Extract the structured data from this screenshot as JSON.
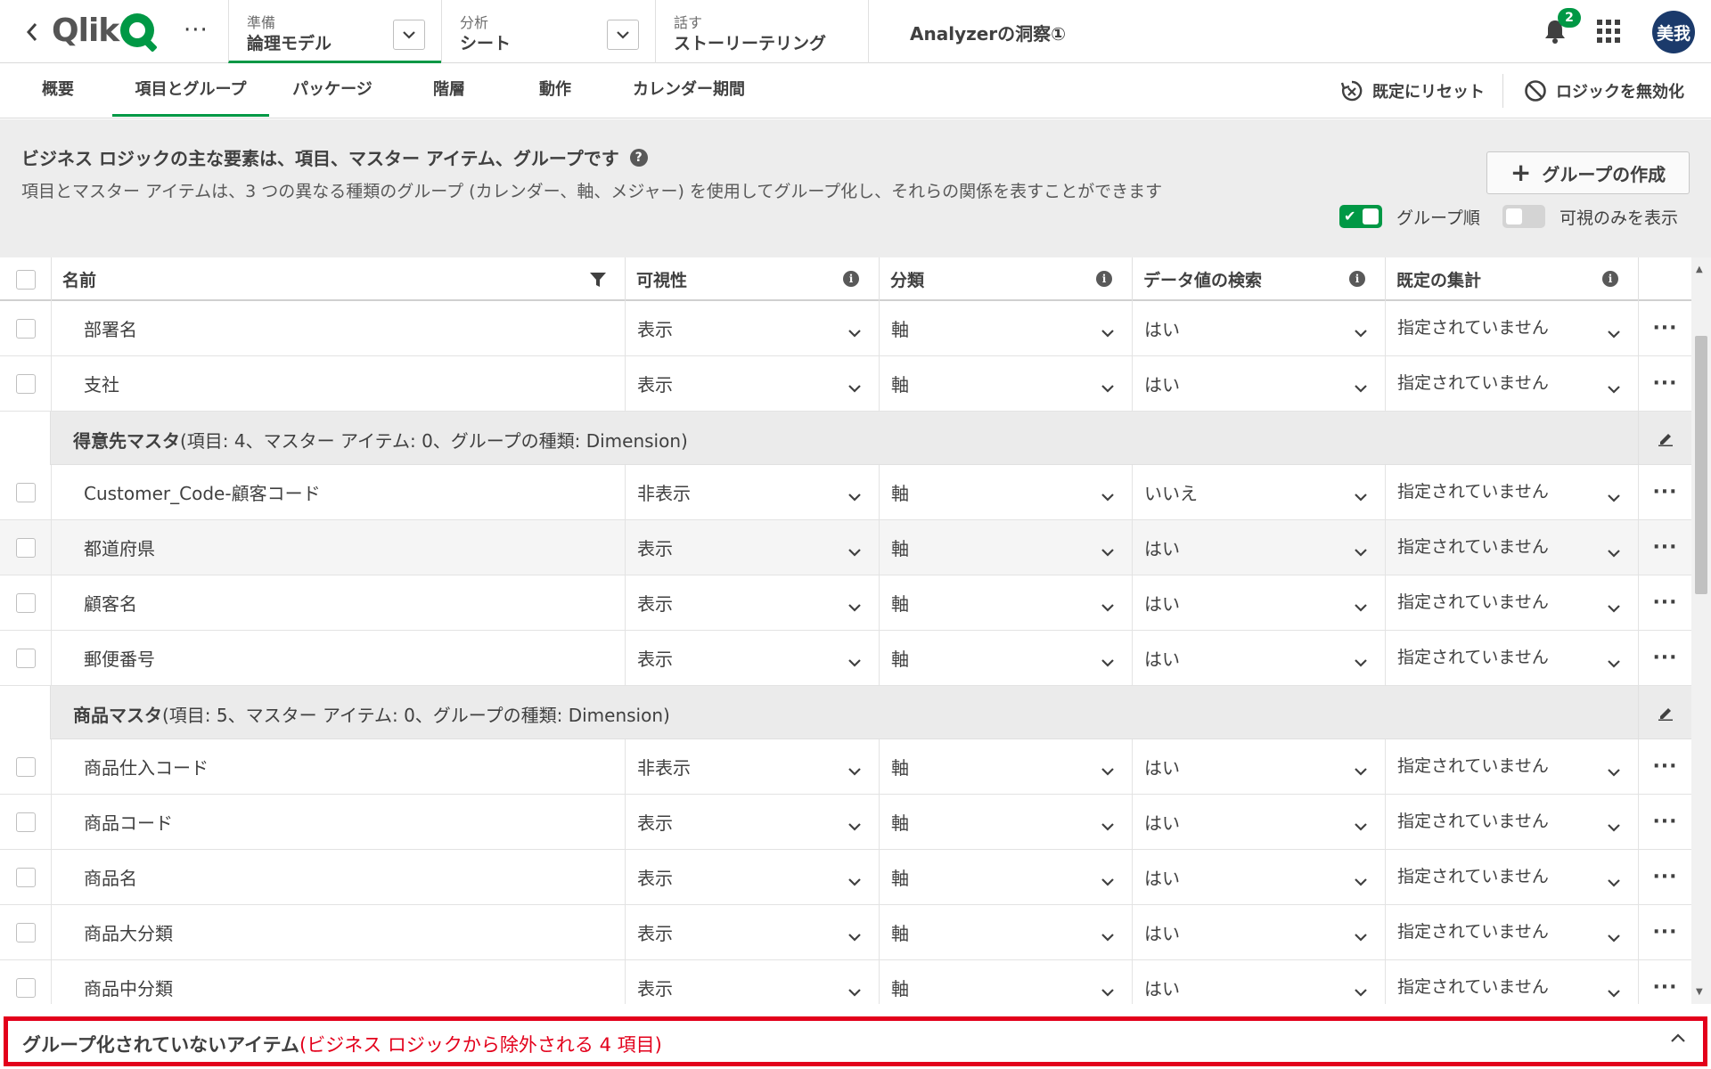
{
  "topbar": {
    "stages": [
      {
        "sublabel": "準備",
        "label": "論理モデル"
      },
      {
        "sublabel": "分析",
        "label": "シート"
      },
      {
        "sublabel": "話す",
        "label": "ストーリーテリング"
      }
    ],
    "app_title": "Analyzerの洞察①",
    "notification_count": "2",
    "avatar_initials": "美我",
    "logo_text": "Qlik"
  },
  "tabs": [
    {
      "label": "概要"
    },
    {
      "label": "項目とグループ"
    },
    {
      "label": "パッケージ"
    },
    {
      "label": "階層"
    },
    {
      "label": "動作"
    },
    {
      "label": "カレンダー期間"
    }
  ],
  "toolbar": {
    "reset_label": "既定にリセット",
    "disable_logic_label": "ロジックを無効化"
  },
  "info": {
    "title": "ビジネス ロジックの主な要素は、項目、マスター アイテム、グループです",
    "description": "項目とマスター アイテムは、3 つの異なる種類のグループ (カレンダー、軸、メジャー) を使用してグループ化し、それらの関係を表すことができます",
    "create_group_label": "グループの作成",
    "group_order_label": "グループ順",
    "visible_only_label": "可視のみを表示"
  },
  "table": {
    "columns": {
      "name": "名前",
      "visibility": "可視性",
      "classification": "分類",
      "search": "データ値の検索",
      "aggregation": "既定の集計"
    },
    "rows": [
      {
        "type": "item",
        "name": "部署名",
        "visibility": "表示",
        "classification": "軸",
        "search": "はい",
        "aggregation": "指定されていません"
      },
      {
        "type": "item",
        "name": "支社",
        "visibility": "表示",
        "classification": "軸",
        "search": "はい",
        "aggregation": "指定されていません"
      },
      {
        "type": "group",
        "title": "得意先マスタ",
        "detail": "(項目: 4、マスター アイテム: 0、グループの種類: Dimension)"
      },
      {
        "type": "item",
        "name": "Customer_Code-顧客コード",
        "visibility": "非表示",
        "classification": "軸",
        "search": "いいえ",
        "aggregation": "指定されていません"
      },
      {
        "type": "item",
        "name": "都道府県",
        "visibility": "表示",
        "classification": "軸",
        "search": "はい",
        "aggregation": "指定されていません",
        "hover": true
      },
      {
        "type": "item",
        "name": "顧客名",
        "visibility": "表示",
        "classification": "軸",
        "search": "はい",
        "aggregation": "指定されていません"
      },
      {
        "type": "item",
        "name": "郵便番号",
        "visibility": "表示",
        "classification": "軸",
        "search": "はい",
        "aggregation": "指定されていません"
      },
      {
        "type": "group",
        "title": "商品マスタ",
        "detail": "(項目: 5、マスター アイテム: 0、グループの種類: Dimension)"
      },
      {
        "type": "item",
        "name": "商品仕入コード",
        "visibility": "非表示",
        "classification": "軸",
        "search": "はい",
        "aggregation": "指定されていません"
      },
      {
        "type": "item",
        "name": "商品コード",
        "visibility": "表示",
        "classification": "軸",
        "search": "はい",
        "aggregation": "指定されていません"
      },
      {
        "type": "item",
        "name": "商品名",
        "visibility": "表示",
        "classification": "軸",
        "search": "はい",
        "aggregation": "指定されていません"
      },
      {
        "type": "item",
        "name": "商品大分類",
        "visibility": "表示",
        "classification": "軸",
        "search": "はい",
        "aggregation": "指定されていません"
      },
      {
        "type": "item",
        "name": "商品中分類",
        "visibility": "表示",
        "classification": "軸",
        "search": "はい",
        "aggregation": "指定されていません"
      }
    ]
  },
  "ungrouped": {
    "title": "グループ化されていないアイテム",
    "detail": "ビジネス ロジックから除外される 4 項目"
  },
  "colors": {
    "accent": "#009845",
    "alert": "#e3001b",
    "avatar": "#1b3a6b"
  }
}
